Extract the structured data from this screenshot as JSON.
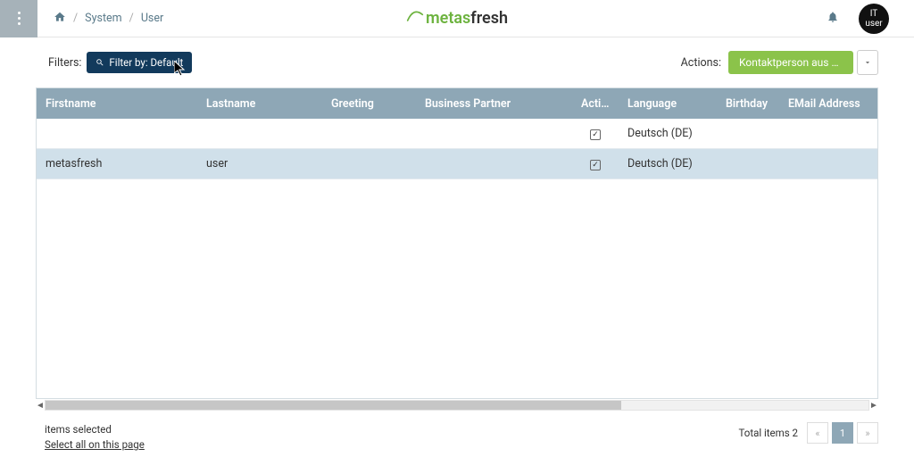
{
  "header": {
    "breadcrumb": {
      "item1": "System",
      "item2": "User"
    },
    "logo": {
      "meta": "metas",
      "fresh": "fresh"
    },
    "avatar": {
      "line1": "IT",
      "line2": "user"
    }
  },
  "toolbar": {
    "filters_label": "Filters:",
    "filter_button": "Filter by: Default",
    "actions_label": "Actions:",
    "action_button": "Kontaktperson aus Nut…"
  },
  "table": {
    "headers": {
      "firstname": "Firstname",
      "lastname": "Lastname",
      "greeting": "Greeting",
      "business_partner": "Business Partner",
      "active": "Active",
      "language": "Language",
      "birthday": "Birthday",
      "email": "EMail Address"
    },
    "rows": {
      "r0": {
        "firstname": "",
        "lastname": "",
        "greeting": "",
        "bp": "",
        "active": "✓",
        "language": "Deutsch (DE)",
        "birthday": "",
        "email": ""
      },
      "r1": {
        "firstname": "metasfresh",
        "lastname": "user",
        "greeting": "",
        "bp": "",
        "active": "✓",
        "language": "Deutsch (DE)",
        "birthday": "",
        "email": ""
      }
    }
  },
  "footer": {
    "items_selected": "items selected",
    "select_all": "Select all on this page",
    "total_label": "Total items 2",
    "prev": "«",
    "page": "1",
    "next": "»"
  }
}
